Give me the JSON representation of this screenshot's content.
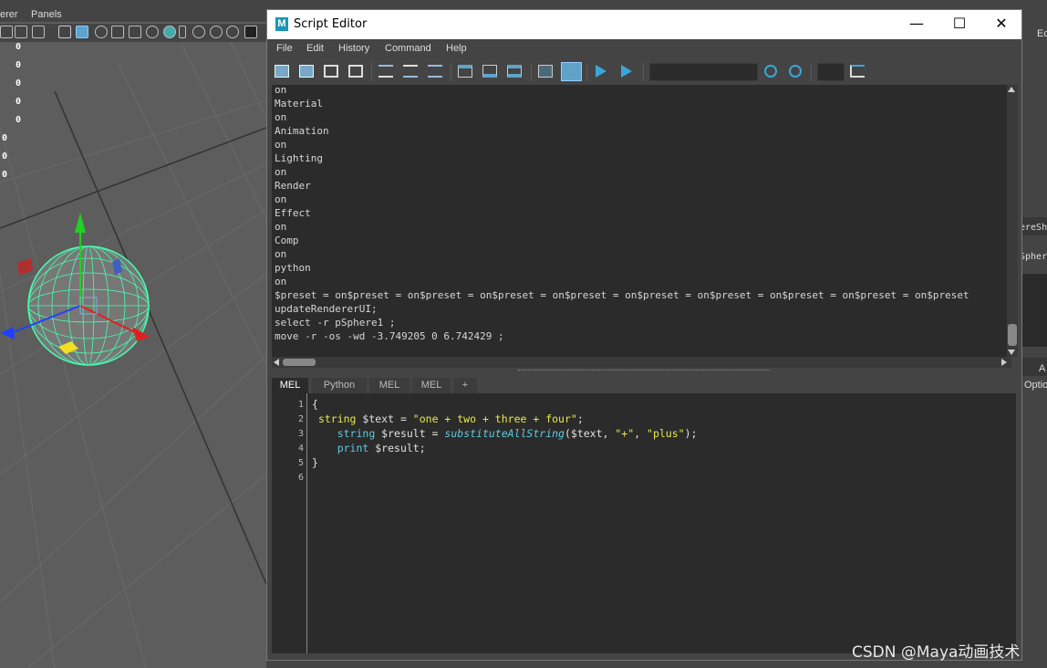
{
  "viewport": {
    "menu": [
      "erer",
      "Panels"
    ],
    "hud_values": [
      "0",
      "0",
      "0",
      "0",
      "0",
      "0",
      "0",
      "0"
    ]
  },
  "right_panel": {
    "edit_label": "Ec",
    "label_sh": "ereSh",
    "label_sphere": "Spher",
    "label_a": "A",
    "label_opti": "Optio"
  },
  "window": {
    "title": "Script Editor",
    "logo": "M",
    "minimize": "—",
    "maximize": "☐",
    "close": "✕"
  },
  "menu": [
    "File",
    "Edit",
    "History",
    "Command",
    "Help"
  ],
  "toolbar": {
    "icons": [
      "open-script-icon",
      "source-script-icon",
      "save-script-icon",
      "save-to-shelf-icon",
      "clear-history-icon",
      "clear-input-icon",
      "clear-all-icon",
      "show-history-icon",
      "show-input-icon",
      "show-both-icon",
      "echo-commands-icon",
      "show-line-numbers-icon",
      "execute-selected-icon",
      "execute-all-icon",
      "search-next-icon",
      "search-prev-icon",
      "goto-line-icon"
    ],
    "search_placeholder": ""
  },
  "output_lines": [
    "on",
    "Material",
    "on",
    "Animation",
    "on",
    "Lighting",
    "on",
    "Render",
    "on",
    "Effect",
    "on",
    "Comp",
    "on",
    "python",
    "on",
    "$preset = on$preset = on$preset = on$preset = on$preset = on$preset = on$preset = on$preset = on$preset = on$preset",
    "updateRendererUI;",
    "select -r pSphere1 ;",
    "move -r -os -wd -3.749205 0 6.742429 ;"
  ],
  "tabs": [
    "MEL",
    "Python",
    "MEL",
    "MEL",
    "+"
  ],
  "line_numbers": [
    "1",
    "2",
    "3",
    "4",
    "5",
    "6"
  ],
  "code": {
    "l1": "{",
    "l2_kw": "string",
    "l2_var": " $text = ",
    "l2_str": "\"one + two + three + four\"",
    "l2_end": ";",
    "l3_indent": "    ",
    "l3_kw": "string",
    "l3_var": " $result = ",
    "l3_fn": "substituteAllString",
    "l3_args1": "($text, ",
    "l3_str1": "\"+\"",
    "l3_sep": ", ",
    "l3_str2": "\"plus\"",
    "l3_end": ");",
    "l4_indent": "    ",
    "l4_kw": "print",
    "l4_rest": " $result;",
    "l5": "}"
  },
  "watermark": "CSDN @Maya动画技术"
}
